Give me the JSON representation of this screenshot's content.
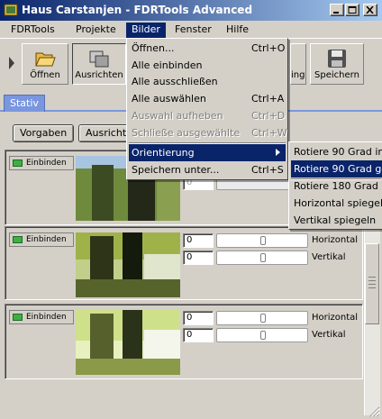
{
  "window": {
    "title": "Haus Carstanjen - FDRTools Advanced"
  },
  "menubar": [
    "FDRTools",
    "Projekte",
    "Bilder",
    "Fenster",
    "Hilfe"
  ],
  "toolbar": {
    "buttons": [
      {
        "label": "Öffnen",
        "icon": "folder-open-icon"
      },
      {
        "label": "Ausrichten",
        "icon": "align-icon"
      },
      {
        "label": "ing",
        "icon": "tonemapping-icon"
      },
      {
        "label": "Speichern",
        "icon": "floppy-disk-icon"
      }
    ]
  },
  "tabs": [
    "Stativ"
  ],
  "subbar": {
    "buttons": [
      "Vorgaben",
      "Ausricht"
    ]
  },
  "panels": [
    {
      "toggle_label": "Einbinden",
      "offset_value": "0",
      "rows": []
    },
    {
      "toggle_label": "Einbinden",
      "rows": [
        {
          "value": "0",
          "label": "Horizontal"
        },
        {
          "value": "0",
          "label": "Vertikal"
        }
      ]
    },
    {
      "toggle_label": "Einbinden",
      "rows": [
        {
          "value": "0",
          "label": "Horizontal"
        },
        {
          "value": "0",
          "label": "Vertikal"
        }
      ]
    }
  ],
  "bilder_menu": {
    "items": [
      {
        "label": "Öffnen...",
        "shortcut": "Ctrl+O",
        "enabled": true
      },
      {
        "label": "Alle einbinden",
        "shortcut": "",
        "enabled": true
      },
      {
        "label": "Alle ausschließen",
        "shortcut": "",
        "enabled": true
      },
      {
        "label": "Alle auswählen",
        "shortcut": "Ctrl+A",
        "enabled": true
      },
      {
        "label": "Auswahl aufheben",
        "shortcut": "Ctrl+D",
        "enabled": false
      },
      {
        "label": "Schließe ausgewählte",
        "shortcut": "Ctrl+W",
        "enabled": false
      },
      {
        "label": "Orientierung",
        "shortcut": "",
        "enabled": true,
        "submenu": true
      },
      {
        "label": "Speichern unter...",
        "shortcut": "Ctrl+S",
        "enabled": true
      }
    ]
  },
  "orientierung_submenu": {
    "items": [
      "Rotiere 90 Grad im",
      "Rotiere 90 Grad ge",
      "Rotiere 180 Grad",
      "Horizontal spiegel",
      "Vertikal spiegeln"
    ]
  },
  "colors": {
    "titlebar_start": "#0a246a",
    "titlebar_end": "#a6caf0",
    "menu_highlight": "#0a246a",
    "tab_active": "#7a96df",
    "led_on": "#3cb043"
  }
}
